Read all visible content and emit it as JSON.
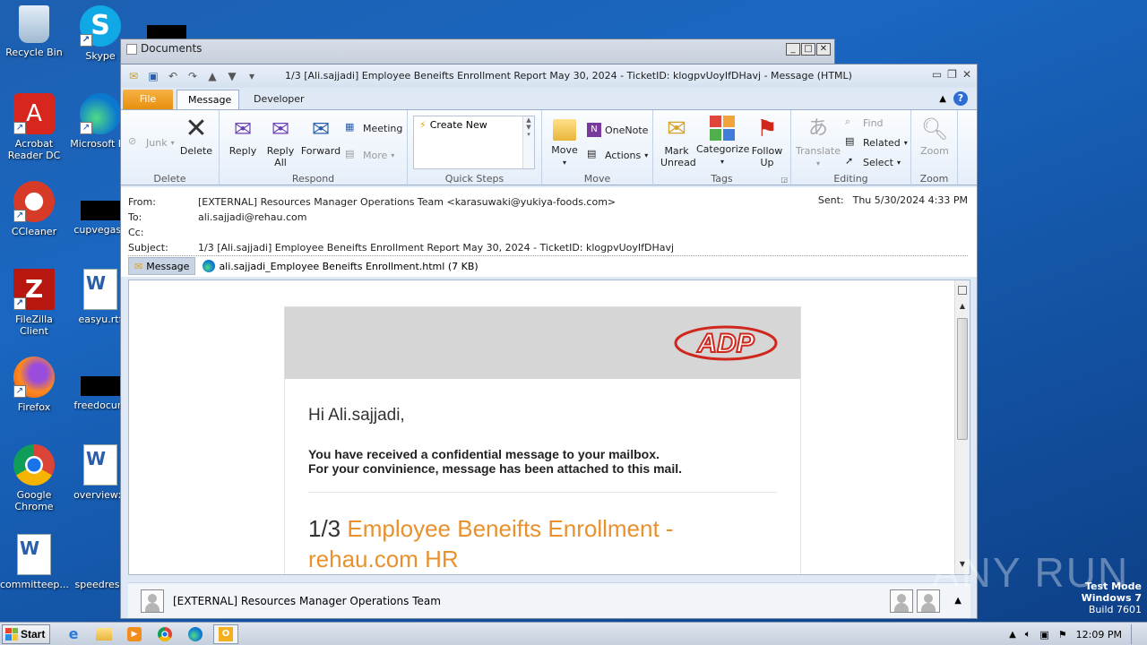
{
  "desktop": {
    "icons": [
      {
        "label": "Recycle Bin"
      },
      {
        "label": "Skype"
      },
      {
        "label": "Acrobat Reader DC"
      },
      {
        "label": "Microsoft Ed"
      },
      {
        "label": "CCleaner"
      },
      {
        "label": "cupvegas.j"
      },
      {
        "label": "FileZilla Client"
      },
      {
        "label": "easyu.rtf"
      },
      {
        "label": "Firefox"
      },
      {
        "label": "freedocum"
      },
      {
        "label": "Google Chrome"
      },
      {
        "label": "overviewx."
      },
      {
        "label": "committeep..."
      },
      {
        "label": "speedresp"
      }
    ]
  },
  "documents_window": {
    "title": "Documents"
  },
  "message_window": {
    "title": "1/3  [Ali.sajjadi] Employee Beneifts Enrollment Report May 30, 2024  - TicketID: klogpvUoyIfDHavj  -  Message (HTML)",
    "tabs": {
      "file": "File",
      "message": "Message",
      "developer": "Developer"
    },
    "ribbon": {
      "junk": "Junk",
      "delete": "Delete",
      "group_delete": "Delete",
      "reply": "Reply",
      "reply_all": "Reply All",
      "forward": "Forward",
      "meeting": "Meeting",
      "more": "More",
      "group_respond": "Respond",
      "create_new": "Create New",
      "group_quick_steps": "Quick Steps",
      "move": "Move",
      "onenote": "OneNote",
      "actions": "Actions",
      "group_move": "Move",
      "mark_unread": "Mark Unread",
      "categorize": "Categorize",
      "follow_up": "Follow Up",
      "group_tags": "Tags",
      "translate": "Translate",
      "find": "Find",
      "related": "Related",
      "select": "Select",
      "group_editing": "Editing",
      "zoom": "Zoom",
      "group_zoom": "Zoom"
    },
    "header": {
      "from_label": "From:",
      "from_value": "[EXTERNAL] Resources Manager Operations Team <karasuwaki@yukiya-foods.com>",
      "to_label": "To:",
      "to_value": "ali.sajjadi@rehau.com",
      "cc_label": "Cc:",
      "subject_label": "Subject:",
      "subject_value": "1/3  [Ali.sajjadi] Employee Beneifts Enrollment Report May 30, 2024  - TicketID: klogpvUoyIfDHavj",
      "sent_label": "Sent:",
      "sent_value": "Thu 5/30/2024 4:33 PM",
      "att_message": "Message",
      "att_file": "ali.sajjadi_Employee Beneifts Enrollment.html (7 KB)"
    },
    "body": {
      "greeting": "Hi Ali.sajjadi,",
      "line1": "You have received a confidential message to your mailbox.",
      "line2": "For your convinience, message has been attached to this mail.",
      "title_prefix": "1/3",
      "title_orange": "Employee Beneifts Enrollment - rehau.com HR"
    },
    "people_pane": {
      "name": "[EXTERNAL] Resources Manager Operations Team"
    }
  },
  "taskbar": {
    "start": "Start",
    "time": "12:09 PM"
  },
  "watermark": {
    "line1": "Test Mode",
    "line2": "Windows 7",
    "line3": "Build 7601",
    "brand": "ANY RUN"
  },
  "colors": {
    "accent_orange": "#e8912d",
    "adp_red": "#d0271d",
    "file_tab": "#e88f0e"
  }
}
